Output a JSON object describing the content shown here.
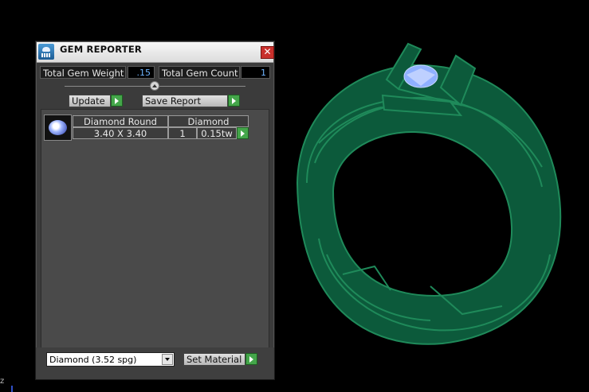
{
  "panel": {
    "title": "GEM REPORTER",
    "close_symbol": "✕",
    "total_gem_weight_label": "Total Gem Weight",
    "total_gem_weight_value": ".15",
    "total_gem_count_label": "Total Gem Count",
    "total_gem_count_value": "1",
    "update_label": "Update",
    "save_report_label": "Save Report",
    "table": {
      "rows": [
        {
          "shape": "Diamond Round",
          "size": "3.40 X 3.40",
          "material": "Diamond",
          "count": "1",
          "weight": "0.15tw"
        }
      ]
    },
    "material_select_value": "Diamond     (3.52 spg)",
    "set_material_label": "Set Material"
  },
  "viewport": {
    "axis_label": "z",
    "ring_color": "#1f8a5a",
    "gem_color": "#8fb0ff"
  },
  "icons": {
    "title": "gem-reporter-icon",
    "close": "close-icon",
    "go": "play-arrow-icon"
  }
}
